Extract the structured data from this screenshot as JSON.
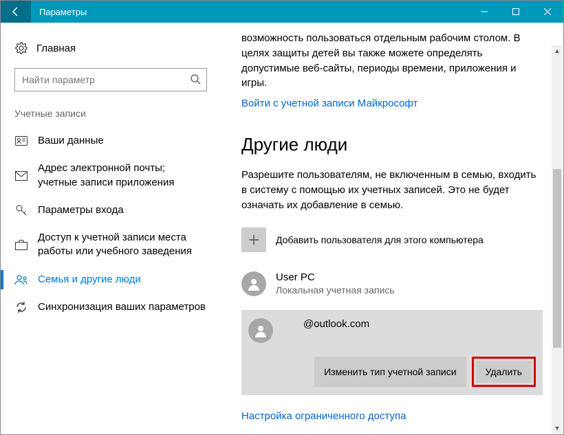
{
  "window": {
    "title": "Параметры"
  },
  "sidebar": {
    "home_label": "Главная",
    "search_placeholder": "Найти параметр",
    "section_label": "Учетные записи",
    "items": [
      {
        "label": "Ваши данные"
      },
      {
        "label": "Адрес электронной почты; учетные записи приложения"
      },
      {
        "label": "Параметры входа"
      },
      {
        "label": "Доступ к учетной записи места работы или учебного заведения"
      },
      {
        "label": "Семья и другие люди"
      },
      {
        "label": "Синхронизация ваших параметров"
      }
    ]
  },
  "main": {
    "intro": "возможность пользоваться отдельным рабочим столом. В целях защиты детей вы также можете определять допустимые веб-сайты, периоды времени, приложения и игры.",
    "signin_link": "Войти с учетной записи Майкрософт",
    "heading": "Другие люди",
    "desc": "Разрешите пользователям, не включенным в семью, входить в систему с помощью их учетных записей. Это не будет означать их добавление в семью.",
    "add_user_label": "Добавить пользователя для этого компьютера",
    "users": [
      {
        "name": "User PC",
        "sub": "Локальная учетная запись"
      },
      {
        "name": "@outlook.com",
        "sub": ""
      }
    ],
    "change_type_btn": "Изменить тип учетной записи",
    "delete_btn": "Удалить",
    "restricted_link": "Настройка ограниченного доступа"
  }
}
